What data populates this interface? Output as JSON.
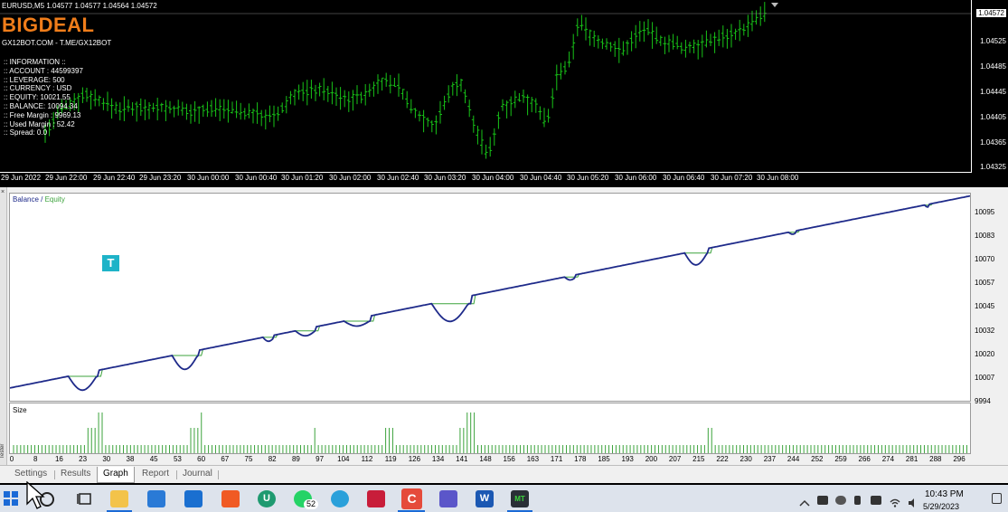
{
  "price_chart": {
    "symbol_header": "EURUSD,M5  1.04577 1.04577 1.04564 1.04572",
    "brand": "BIGDEAL",
    "brand_site": "GX12BOT.COM - T.ME/GX12BOT",
    "info_lines": [
      ":: INFORMATION ::",
      ":: ACCOUNT : 44599397",
      ":: LEVERAGE: 500",
      ":: CURRENCY : USD",
      ":: EQUITY: 10021.55",
      ":: BALANCE: 10094.34",
      ":: Free Margin : 9969.13",
      ":: Used Margin : 52.42",
      ":: Spread: 0.0"
    ],
    "current_price": "1.04572",
    "price_levels": [
      "1.04525",
      "1.04485",
      "1.04445",
      "1.04405",
      "1.04365",
      "1.04325"
    ],
    "time_labels": [
      "29 Jun 2022",
      "29 Jun 22:00",
      "29 Jun 22:40",
      "29 Jun 23:20",
      "30 Jun 00:00",
      "30 Jun 00:40",
      "30 Jun 01:20",
      "30 Jun 02:00",
      "30 Jun 02:40",
      "30 Jun 03:20",
      "30 Jun 04:00",
      "30 Jun 04:40",
      "30 Jun 05:20",
      "30 Jun 06:00",
      "30 Jun 06:40",
      "30 Jun 07:20",
      "30 Jun 08:00"
    ],
    "bar_color": "#18c418"
  },
  "tester": {
    "legend_balance": "Balance",
    "legend_sep": " / ",
    "legend_equity": "Equity",
    "size_label": "Size",
    "t_icon": "T",
    "sidebar_x": "×",
    "sidebar_label": "Tester",
    "balance_color": "#1e2a8a",
    "equity_color": "#3ca33c",
    "y_labels": [
      "10095",
      "10083",
      "10070",
      "10057",
      "10045",
      "10032",
      "10020",
      "10007",
      "9994"
    ],
    "x_labels": [
      "0",
      "8",
      "16",
      "23",
      "30",
      "38",
      "45",
      "53",
      "60",
      "67",
      "75",
      "82",
      "89",
      "97",
      "104",
      "112",
      "119",
      "126",
      "134",
      "141",
      "148",
      "156",
      "163",
      "171",
      "178",
      "185",
      "193",
      "200",
      "207",
      "215",
      "222",
      "230",
      "237",
      "244",
      "252",
      "259",
      "266",
      "274",
      "281",
      "288",
      "296"
    ],
    "tabs": [
      "Settings",
      "Results",
      "Graph",
      "Report",
      "Journal"
    ],
    "active_tab": "Graph"
  },
  "chart_data": {
    "type": "line",
    "x": [
      0,
      296
    ],
    "series": [
      {
        "name": "Balance",
        "values": [
          10000,
          10097
        ]
      },
      {
        "name": "Equity",
        "values": [
          10000,
          10097
        ]
      }
    ],
    "ylabel": "",
    "xlabel": "",
    "ylim": [
      9994,
      10095
    ],
    "xlim": [
      0,
      296
    ],
    "legend": "top-left",
    "grid": false
  },
  "taskbar": {
    "whatsapp_badge": "52",
    "time": "10:43 PM",
    "date": "5/29/2023",
    "icons": [
      "windows-start",
      "search",
      "task-view",
      "file-explorer",
      "microsoft-store",
      "mail",
      "brave",
      "upwork",
      "whatsapp",
      "telegram",
      "screen-recorder",
      "camtasia",
      "app",
      "word",
      "metatrader"
    ],
    "word_glyph": "W",
    "camtasia_glyph": "C",
    "upwork_glyph": "U",
    "mt4_glyph": "MT"
  }
}
